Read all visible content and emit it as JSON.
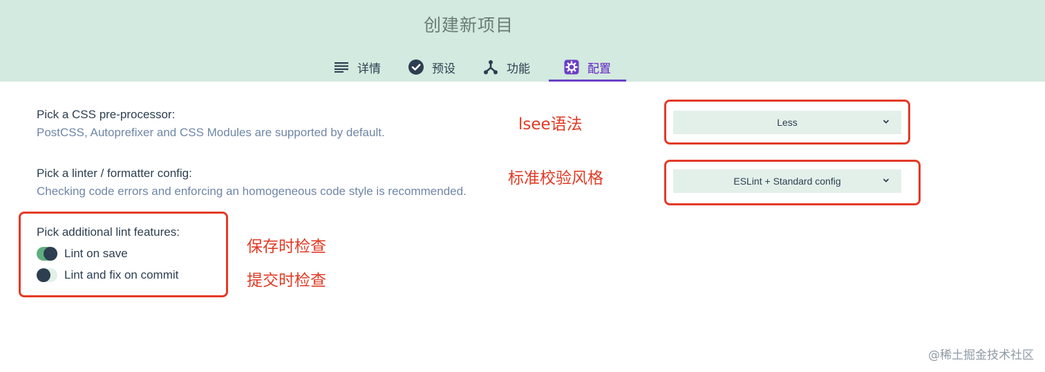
{
  "header": {
    "title": "创建新项目",
    "tabs": [
      {
        "label": "详情",
        "icon": "list-icon"
      },
      {
        "label": "预设",
        "icon": "check-circle-icon"
      },
      {
        "label": "功能",
        "icon": "fork-icon"
      },
      {
        "label": "配置",
        "icon": "settings-icon",
        "active": true
      }
    ]
  },
  "config": {
    "css": {
      "label": "Pick a CSS pre-processor:",
      "description": "PostCSS, Autoprefixer and CSS Modules are supported by default.",
      "selected": "Less"
    },
    "linter": {
      "label": "Pick a linter / formatter config:",
      "description": "Checking code errors and enforcing an homogeneous code style is recommended.",
      "selected": "ESLint + Standard config"
    },
    "lint_features": {
      "label": "Pick additional lint features:",
      "options": [
        {
          "label": "Lint on save",
          "enabled": true
        },
        {
          "label": "Lint and fix on commit",
          "enabled": false
        }
      ]
    }
  },
  "annotations": [
    "lsee语法",
    "标准校验风格",
    "保存时检查",
    "提交时检查"
  ],
  "watermark": "@稀土掘金技术社区",
  "colors": {
    "header_bg": "#d2eadf",
    "accent": "#6b3fc4",
    "annotation": "#e33a26",
    "toggle_on": "#5fae7e"
  }
}
